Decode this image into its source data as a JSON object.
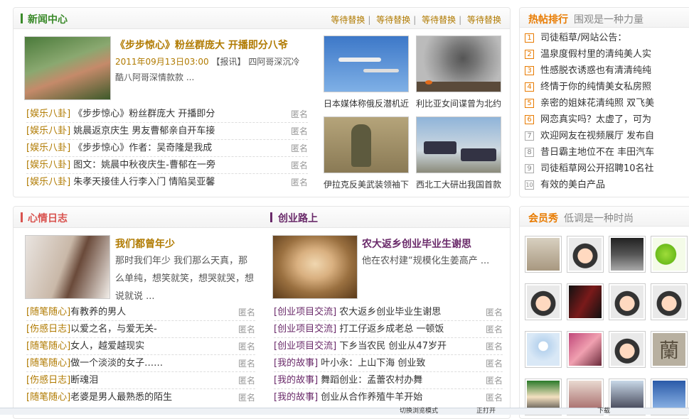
{
  "news": {
    "title": "新闻中心",
    "links": [
      "等待替换",
      "等待替换",
      "等待替换",
      "等待替换"
    ],
    "headline": "《步步惊心》粉丝群庞大 开播即分八爷",
    "date": "2011年09月13日03:00",
    "tag": "【报讯】",
    "summary": "四阿哥深沉冷酷八阿哥深情款款 ...",
    "items": [
      {
        "cat": "[娱乐八卦]",
        "title": "《步步惊心》粉丝群庞大 开播即分",
        "author": "匿名"
      },
      {
        "cat": "[娱乐八卦]",
        "title": "姚晨返京庆生 男友曹郁亲自开车接",
        "author": "匿名"
      },
      {
        "cat": "[娱乐八卦]",
        "title": "《步步惊心》作者：吴奇隆是我成",
        "author": "匿名"
      },
      {
        "cat": "[娱乐八卦]",
        "title": "图文：姚晨中秋夜庆生-曹郁在一旁",
        "author": "匿名"
      },
      {
        "cat": "[娱乐八卦]",
        "title": "朱孝天接佳人行李入门 情陷吴亚馨",
        "author": "匿名"
      }
    ],
    "photos": [
      {
        "caption": "日本媒体称俄反潜机近"
      },
      {
        "caption": "利比亚女间谍曾为北约"
      },
      {
        "caption": "伊拉克反美武装领袖下"
      },
      {
        "caption": "西北工大研出我国首款"
      }
    ]
  },
  "hot": {
    "title": "热帖排行",
    "subtitle": "围观是一种力量",
    "items": [
      {
        "n": "1",
        "text": "司徒稻草/网站公告："
      },
      {
        "n": "2",
        "text": "温泉度假村里的清纯美人实"
      },
      {
        "n": "3",
        "text": "性感脱衣诱惑也有清清纯纯"
      },
      {
        "n": "4",
        "text": "终情于你的纯情美女私房照"
      },
      {
        "n": "5",
        "text": "亲密的姐妹花清纯照 双飞美"
      },
      {
        "n": "6",
        "text": "网恋真实吗？太虚了，可为"
      },
      {
        "n": "7",
        "text": "欢迎网友在视频展厅 发布自"
      },
      {
        "n": "8",
        "text": "昔日霸主地位不在 丰田汽车"
      },
      {
        "n": "9",
        "text": "司徒稻草网公开招聘10名社"
      },
      {
        "n": "10",
        "text": "有效的美白产品"
      }
    ]
  },
  "mood": {
    "title": "心情日志",
    "headline": "我们都曾年少",
    "summary": "那时我们年少 我们那么天真，那么单纯，想笑就笑，想哭就哭，想说就说 ...",
    "items": [
      {
        "cat": "[随笔随心]",
        "title": "有教养的男人",
        "author": "匿名"
      },
      {
        "cat": "[伤感日志]",
        "title": "以爱之名，与爱无关-",
        "author": "匿名"
      },
      {
        "cat": "[随笔随心]",
        "title": "女人，越爱越现实",
        "author": "匿名"
      },
      {
        "cat": "[随笔随心]",
        "title": "做一个淡淡的女子……",
        "author": "匿名"
      },
      {
        "cat": "[伤感日志]",
        "title": "断魂泪",
        "author": "匿名"
      },
      {
        "cat": "[随笔随心]",
        "title": "老婆是男人最熟悉的陌生",
        "author": "匿名"
      }
    ]
  },
  "biz": {
    "title": "创业路上",
    "headline": "农大返乡创业毕业生谢思",
    "summary": "他在农村建“规模化生姜高产 ...",
    "items": [
      {
        "cat": "[创业项目交流]",
        "title": "农大返乡创业毕业生谢思",
        "author": "匿名"
      },
      {
        "cat": "[创业项目交流]",
        "title": "打工仔返乡成老总 一顿饭",
        "author": "匿名"
      },
      {
        "cat": "[创业项目交流]",
        "title": "下乡当农民 创业从47岁开",
        "author": "匿名"
      },
      {
        "cat": "[我的故事]",
        "title": "叶小永：上山下海 创业致",
        "author": "匿名"
      },
      {
        "cat": "[我的故事]",
        "title": "舞蹈创业：孟蕾农村办舞",
        "author": "匿名"
      },
      {
        "cat": "[我的故事]",
        "title": "创业从合作养殖牛羊开始",
        "author": "匿名"
      }
    ]
  },
  "members": {
    "title": "会员秀",
    "subtitle": "低调是一种时尚",
    "char": "蘭"
  },
  "statusbar": {
    "text": "切换浏览模式",
    "open": "正打开",
    "download": "下载"
  },
  "colors": {
    "accent": "#b07a00",
    "green_bar": "#3a8a2a",
    "red_bar": "#d9534f",
    "purple_bar": "#6a2a6a"
  }
}
